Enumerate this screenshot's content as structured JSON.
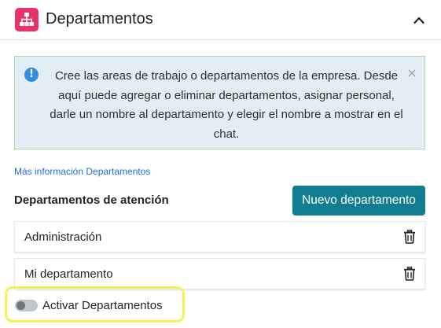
{
  "header": {
    "title": "Departamentos",
    "icon": "sitemap-icon",
    "icon_color": "#e8336a",
    "collapse_icon": "chevron-up-icon"
  },
  "alert": {
    "icon": "info-circle-icon",
    "icon_glyph": "!",
    "text": "Cree las areas de trabajo o departamentos de la empresa. Desde aquí puede agregar o eliminar departamentos, asignar personal, darle un nombre al departamento y elegir el nombre a mostrar en el chat.",
    "close_glyph": "×"
  },
  "more_info_link": "Más información Departamentos",
  "section": {
    "title": "Departamentos de atención",
    "new_button_label": "Nuevo departamento",
    "accent_color": "#127d91"
  },
  "departments": [
    {
      "name": "Administración",
      "delete_icon": "trash-icon"
    },
    {
      "name": "Mi departamento",
      "delete_icon": "trash-icon"
    }
  ],
  "toggle": {
    "label": "Activar Departamentos",
    "checked": false
  }
}
